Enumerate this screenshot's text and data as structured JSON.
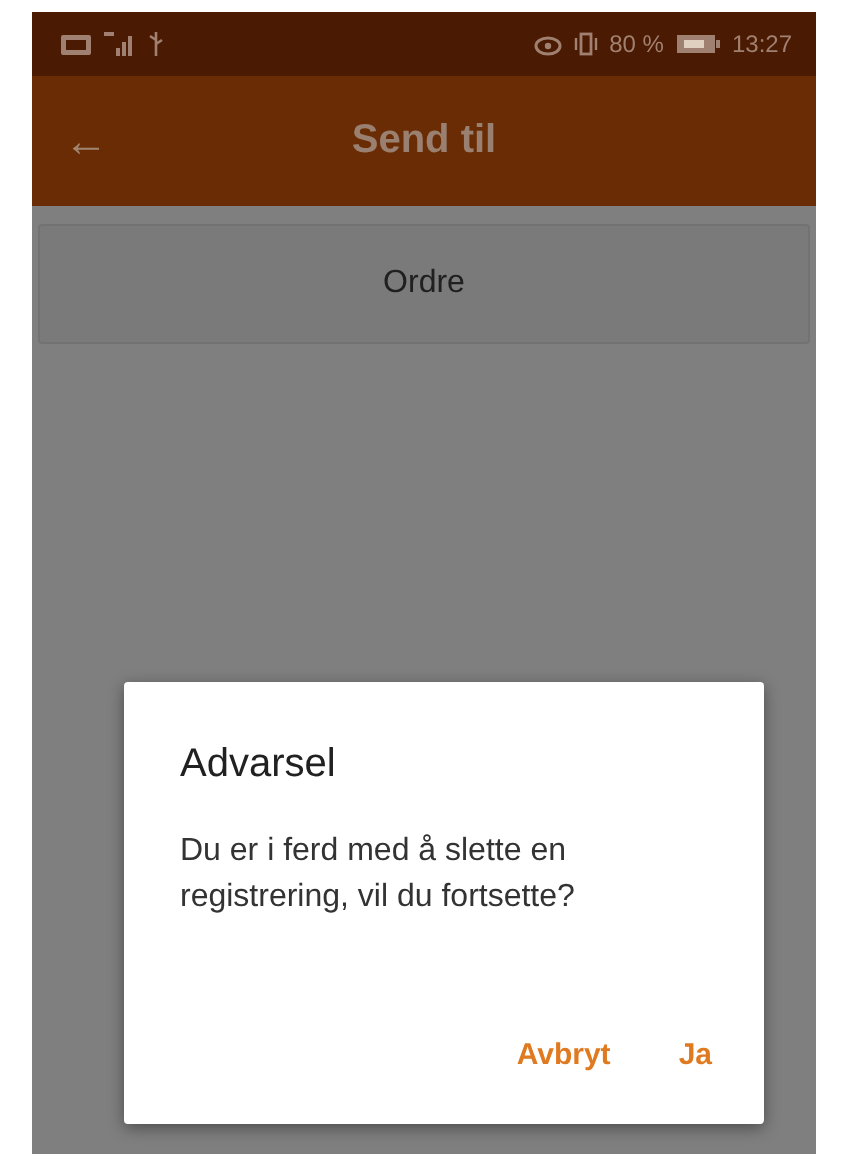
{
  "status_bar": {
    "battery": "80 %",
    "time": "13:27"
  },
  "app_bar": {
    "back": "←",
    "title": "Send til"
  },
  "list": [
    {
      "label": "Ordre"
    }
  ],
  "dialog": {
    "title": "Advarsel",
    "message": "Du er i ferd med å slette en registrering, vil du fortsette?",
    "buttons": [
      {
        "label": "Avbryt"
      },
      {
        "label": "Ja"
      }
    ]
  }
}
